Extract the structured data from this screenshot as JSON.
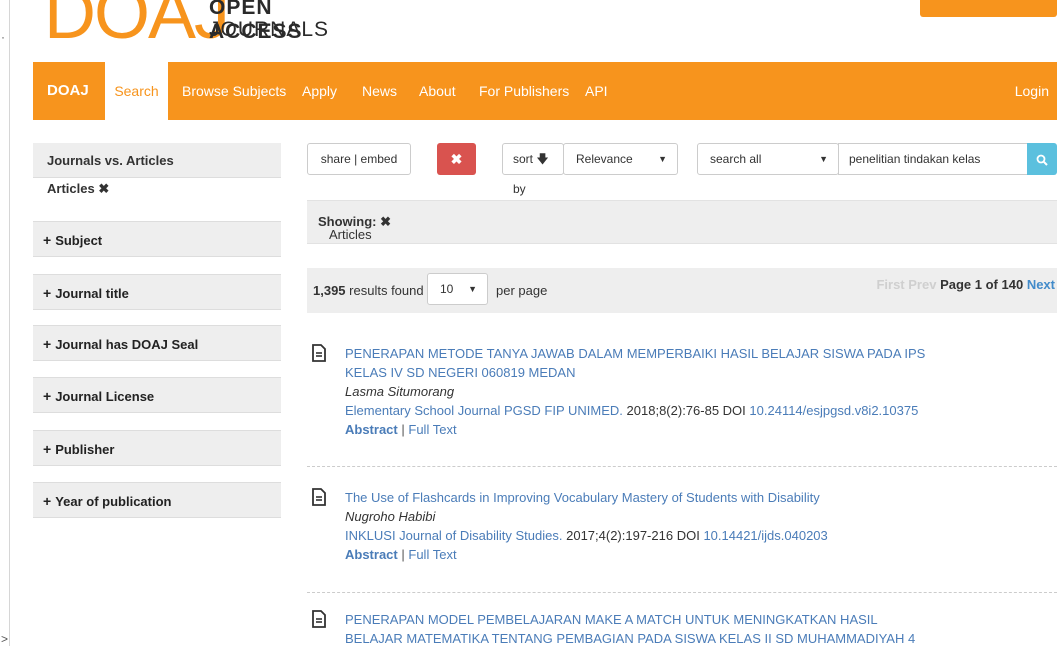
{
  "logo": {
    "letters": "DOAJ",
    "line1": "OPEN ACCESS",
    "line2": "JOURNALS"
  },
  "navbar": {
    "brand": "DOAJ",
    "items": [
      "Search",
      "Browse Subjects",
      "Apply",
      "News",
      "About",
      "For Publishers",
      "API"
    ],
    "login": "Login"
  },
  "sidebar": {
    "header": "Journals vs. Articles",
    "selected": "Articles",
    "remove_icon": "✖",
    "facets": [
      "Subject",
      "Journal title",
      "Journal has DOAJ Seal",
      "Journal License",
      "Publisher",
      "Year of publication"
    ]
  },
  "controls": {
    "share": "share | embed",
    "clear_icon": "✖",
    "sort_label": "sort",
    "sort_by": "by",
    "sort_value": "Relevance",
    "field_value": "search all",
    "query": "penelitian tindakan kelas",
    "search_icon": "search-icon"
  },
  "showing": {
    "label": "Showing:",
    "value": "Articles",
    "remove_icon": "✖"
  },
  "results_bar": {
    "count": "1,395",
    "count_text": "results found",
    "per_page": "10",
    "per_page_label": "per page",
    "first": "First",
    "prev": "Prev",
    "page": "Page 1 of 140",
    "next": "Next"
  },
  "results": [
    {
      "title_line1": "PENERAPAN METODE TANYA JAWAB DALAM MEMPERBAIKI HASIL BELAJAR SISWA PADA IPS",
      "title_line2": "KELAS IV SD NEGERI 060819 MEDAN",
      "author": "Lasma Situmorang",
      "journal": "Elementary School Journal PGSD FIP UNIMED.",
      "citation": "2018;8(2):76-85 DOI",
      "doi": "10.24114/esjpgsd.v8i2.10375",
      "abstract": "Abstract",
      "sep": "|",
      "fulltext": "Full Text"
    },
    {
      "title_line1": "The Use of Flashcards in Improving Vocabulary Mastery of Students with Disability",
      "author": "Nugroho Habibi",
      "journal": "INKLUSI Journal of Disability Studies.",
      "citation": "2017;4(2):197-216 DOI",
      "doi": "10.14421/ijds.040203",
      "abstract": "Abstract",
      "sep": "|",
      "fulltext": "Full Text"
    },
    {
      "title_line1": "PENERAPAN MODEL PEMBELAJARAN MAKE A MATCH UNTUK MENINGKATKAN HASIL",
      "title_line2": "BELAJAR MATEMATIKA TENTANG PEMBAGIAN PADA SISWA KELAS II SD MUHAMMADIYAH 4"
    }
  ],
  "colors": {
    "brand": "#f7941d",
    "link": "#4a7cb8",
    "danger": "#d9534f",
    "info": "#5bc0de"
  }
}
